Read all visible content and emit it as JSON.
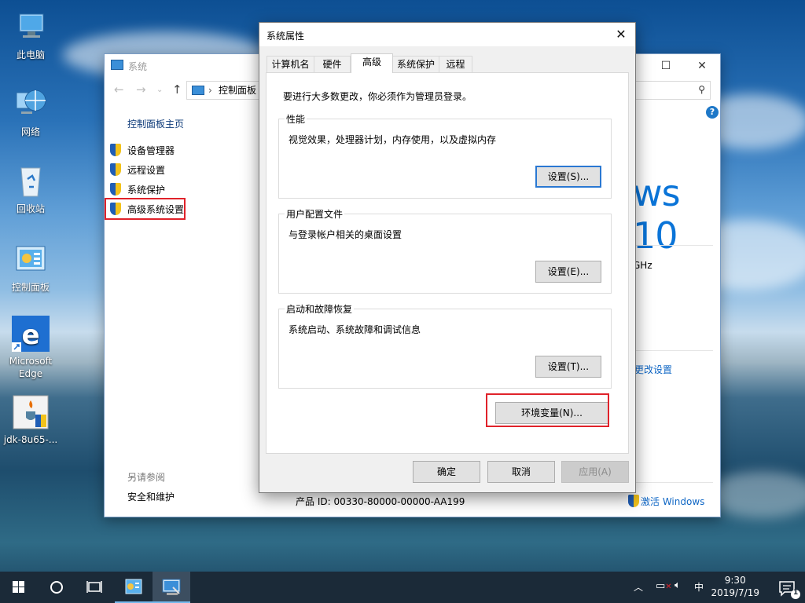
{
  "desktop": {
    "icons": [
      {
        "label": "此电脑"
      },
      {
        "label": "网络"
      },
      {
        "label": "回收站"
      },
      {
        "label": "控制面板"
      },
      {
        "label": "Microsoft Edge"
      },
      {
        "label": "jdk-8u65-..."
      }
    ]
  },
  "system_window": {
    "title": "系统",
    "address": "控制面板",
    "minimize": "—",
    "maximize": "☐",
    "close": "✕",
    "home_link": "控制面板主页",
    "side_items": [
      {
        "label": "设备管理器"
      },
      {
        "label": "远程设置"
      },
      {
        "label": "系统保护"
      },
      {
        "label": "高级系统设置"
      }
    ],
    "see_also": "另请参阅",
    "security_link": "安全和维护",
    "logo_text": "ws 10",
    "cpu_fragment": "GHz",
    "change_settings": "更改设置",
    "product_id": "产品 ID: 00330-80000-00000-AA199",
    "activate": "激活 Windows",
    "help": "?"
  },
  "dialog": {
    "title": "系统属性",
    "close": "✕",
    "tabs": [
      {
        "label": "计算机名"
      },
      {
        "label": "硬件"
      },
      {
        "label": "高级"
      },
      {
        "label": "系统保护"
      },
      {
        "label": "远程"
      }
    ],
    "admin_note": "要进行大多数更改，你必须作为管理员登录。",
    "groups": {
      "performance": {
        "label": "性能",
        "desc": "视觉效果，处理器计划，内存使用，以及虚拟内存",
        "button": "设置(S)..."
      },
      "profile": {
        "label": "用户配置文件",
        "desc": "与登录帐户相关的桌面设置",
        "button": "设置(E)..."
      },
      "startup": {
        "label": "启动和故障恢复",
        "desc": "系统启动、系统故障和调试信息",
        "button": "设置(T)..."
      }
    },
    "env_button": "环境变量(N)...",
    "ok": "确定",
    "cancel": "取消",
    "apply": "应用(A)"
  },
  "taskbar": {
    "ime": "中",
    "time": "9:30",
    "date": "2019/7/19",
    "notification_count": "1"
  }
}
